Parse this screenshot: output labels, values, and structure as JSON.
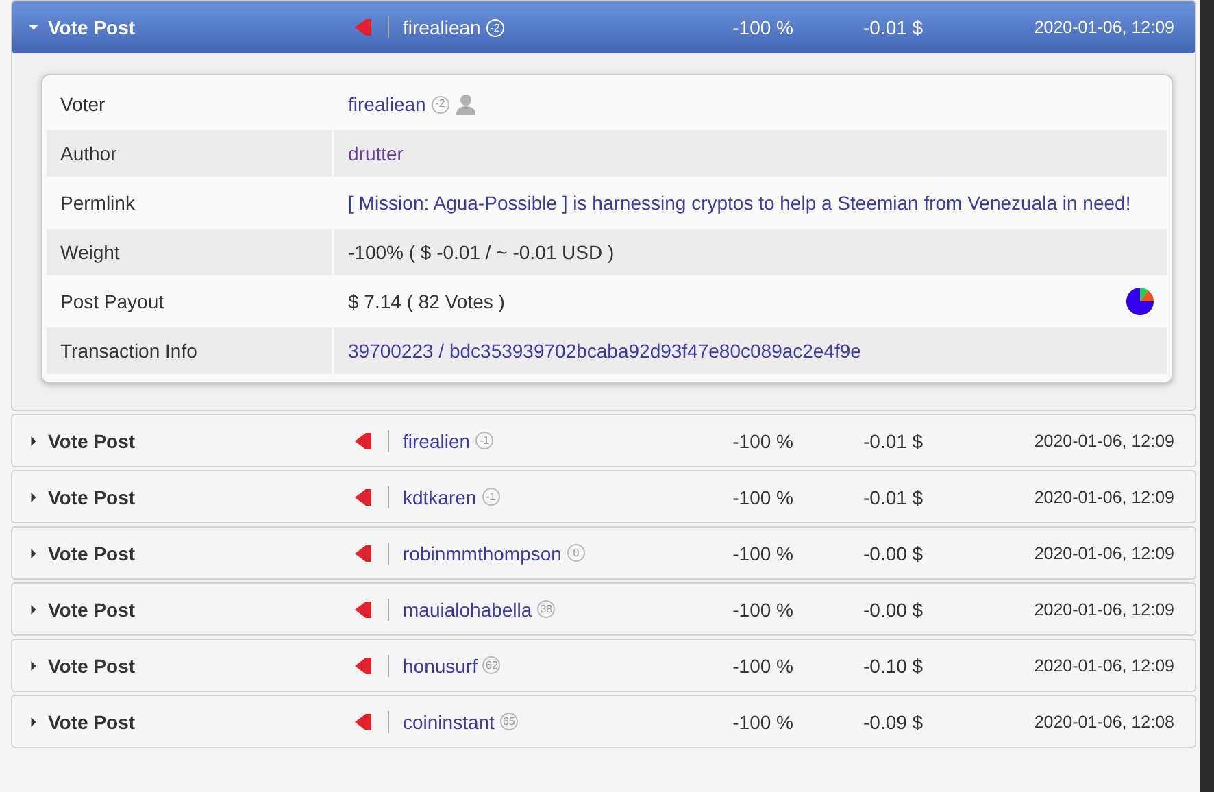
{
  "events": [
    {
      "title": "Vote Post",
      "voter": "firealiean",
      "reputation": "-2",
      "percent": "-100 %",
      "value": "-0.01 $",
      "time": "2020-01-06, 12:09",
      "expanded": true,
      "details": [
        {
          "kind": "user",
          "label": "Voter",
          "value": "firealiean",
          "reputation": "-2"
        },
        {
          "kind": "author",
          "label": "Author",
          "value": "drutter"
        },
        {
          "kind": "link",
          "label": "Permlink",
          "value": "[ Mission: Agua-Possible ] is harnessing cryptos to help a Steemian from Venezuala in need!"
        },
        {
          "kind": "text",
          "label": "Weight",
          "value": "-100% ( $ -0.01 / ~ -0.01 USD )"
        },
        {
          "kind": "payout",
          "label": "Post Payout",
          "value": "$ 7.14 ( 82 Votes )"
        },
        {
          "kind": "link",
          "label": "Transaction Info",
          "value": "39700223 / bdc353939702bcaba92d93f47e80c089ac2e4f9e"
        }
      ]
    },
    {
      "title": "Vote Post",
      "voter": "firealien",
      "reputation": "-1",
      "percent": "-100 %",
      "value": "-0.01 $",
      "time": "2020-01-06, 12:09",
      "expanded": false
    },
    {
      "title": "Vote Post",
      "voter": "kdtkaren",
      "reputation": "-1",
      "percent": "-100 %",
      "value": "-0.01 $",
      "time": "2020-01-06, 12:09",
      "expanded": false
    },
    {
      "title": "Vote Post",
      "voter": "robinmmthompson",
      "reputation": "0",
      "percent": "-100 %",
      "value": "-0.00 $",
      "time": "2020-01-06, 12:09",
      "expanded": false
    },
    {
      "title": "Vote Post",
      "voter": "mauialohabella",
      "reputation": "38",
      "percent": "-100 %",
      "value": "-0.00 $",
      "time": "2020-01-06, 12:09",
      "expanded": false
    },
    {
      "title": "Vote Post",
      "voter": "honusurf",
      "reputation": "62",
      "percent": "-100 %",
      "value": "-0.10 $",
      "time": "2020-01-06, 12:09",
      "expanded": false
    },
    {
      "title": "Vote Post",
      "voter": "coininstant",
      "reputation": "65",
      "percent": "-100 %",
      "value": "-0.09 $",
      "time": "2020-01-06, 12:08",
      "expanded": false
    }
  ]
}
